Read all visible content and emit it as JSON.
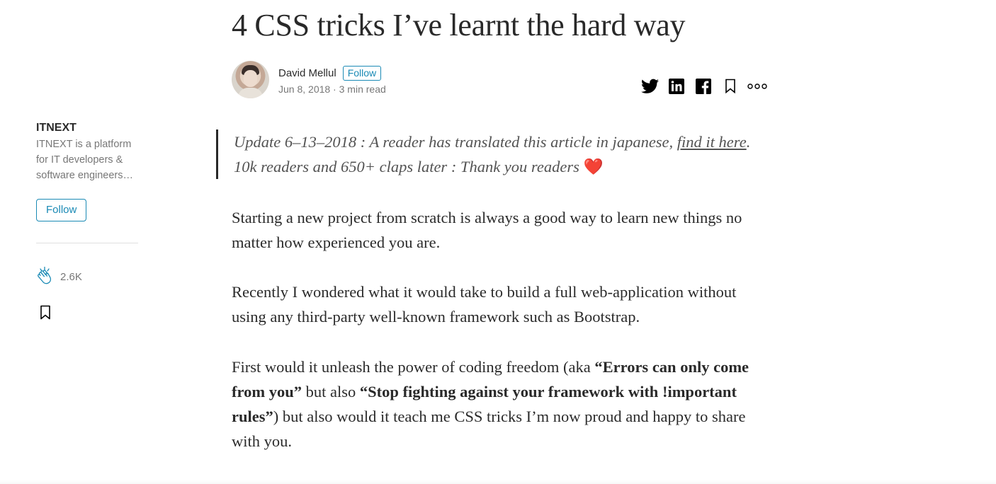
{
  "article": {
    "title": "4 CSS tricks I’ve learnt the hard way"
  },
  "byline": {
    "author": "David Mellul",
    "follow_label": "Follow",
    "date": "Jun 8, 2018",
    "separator": " · ",
    "read_time": "3 min read"
  },
  "share": {
    "icons": [
      "twitter-icon",
      "linkedin-icon",
      "facebook-icon",
      "bookmark-icon",
      "more-icon"
    ]
  },
  "sidebar": {
    "publication": "ITNEXT",
    "description": "ITNEXT is a platform for IT developers & software engineers…",
    "follow_label": "Follow",
    "clap_count": "2.6K"
  },
  "quote": {
    "text_before": "Update 6–13–2018 : A reader has translated this article in japanese, ",
    "link_text": "find it here",
    "text_after": ". 10k readers and 650+ claps later : Thank you readers ",
    "emoji": "❤️"
  },
  "body": {
    "p1": "Starting a new project from scratch is always a good way to learn new things no matter how experienced you are.",
    "p2": "Recently I wondered what it would take to build a full web-application without using any third-party well-known framework such as Bootstrap.",
    "p3_a": "First would it unleash the power of coding freedom (aka ",
    "p3_b": "“Errors can only come from you”",
    "p3_c": " but also ",
    "p3_d": "“Stop fighting against your framework with !important rules”",
    "p3_e": ") but also would it teach me CSS tricks I’m now proud and happy to share with you."
  },
  "colors": {
    "accent": "#1a8ab5",
    "text": "#292929",
    "muted": "#757575"
  }
}
